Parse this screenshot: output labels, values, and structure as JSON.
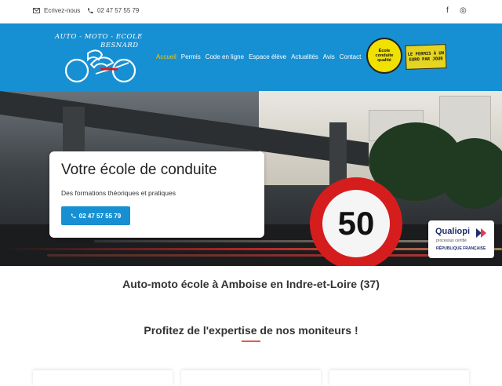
{
  "topbar": {
    "email_label": "Ecrivez-nous",
    "phone_label": "02 47 57 55 79",
    "social": [
      {
        "icon": "facebook-icon",
        "glyph": "f"
      },
      {
        "icon": "instagram-icon",
        "glyph": "◎"
      }
    ]
  },
  "header": {
    "logo_line1": "AUTO - MOTO - ECOLE",
    "logo_line2": "BESNARD",
    "nav": [
      "Accueil",
      "Permis",
      "Code en ligne",
      "Espace élève",
      "Actualités",
      "Avis",
      "Contact"
    ],
    "active_nav": "Accueil",
    "badge_quality": "École conduite qualité",
    "badge_euro": "LE PERMIS À UN EURO PAR JOUR"
  },
  "hero": {
    "title": "Votre école de conduite",
    "subtitle": "Des formations théoriques et pratiques",
    "cta_label": "02 47 57 55 79",
    "speed_sign": "50",
    "qualiopi": {
      "name": "Qualiopi",
      "sub": "processus certifié",
      "republic": "RÉPUBLIQUE FRANÇAISE"
    }
  },
  "main": {
    "location_title": "Auto-moto école à Amboise en Indre-et-Loire (37)",
    "section_title": "Profitez de l'expertise de nos moniteurs !"
  },
  "colors": {
    "brand_blue": "#1790d3",
    "accent_yellow": "#f5c600",
    "accent_red": "#e25b4b"
  }
}
